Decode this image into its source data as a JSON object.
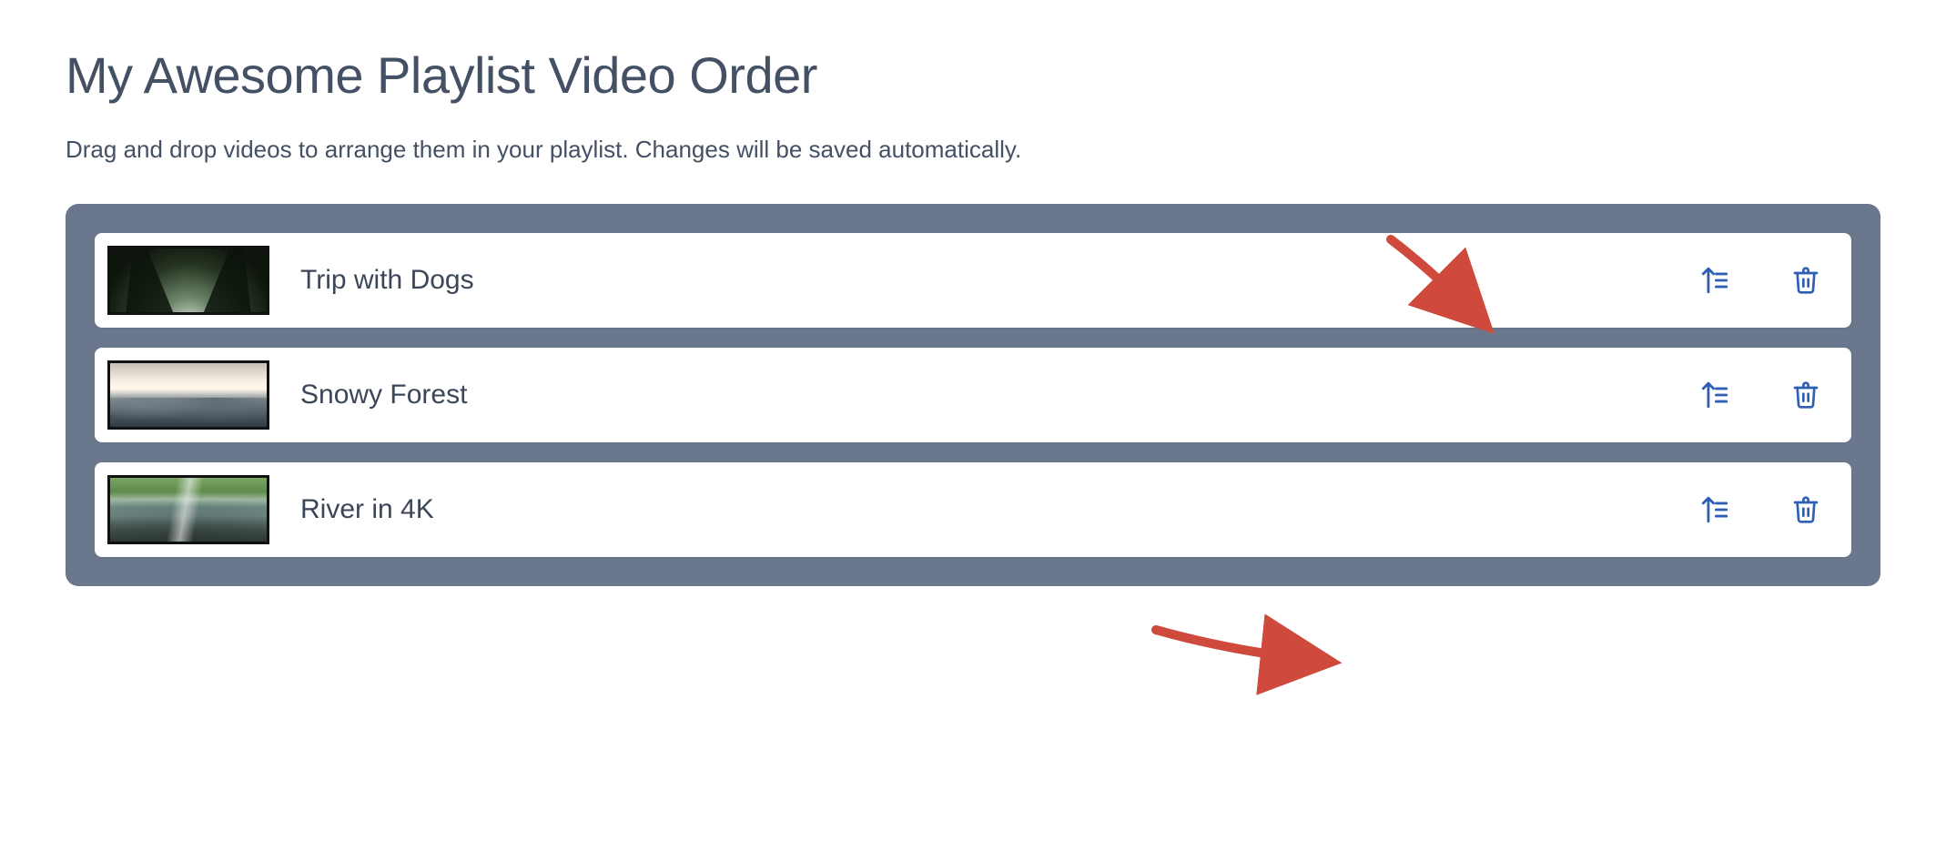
{
  "header": {
    "title": "My Awesome Playlist Video Order",
    "subtitle": "Drag and drop videos to arrange them in your playlist. Changes will be saved automatically."
  },
  "playlist": {
    "items": [
      {
        "title": "Trip with Dogs",
        "thumb_class": "forest-trees"
      },
      {
        "title": "Snowy Forest",
        "thumb_class": "snowy-sunrise"
      },
      {
        "title": "River in 4K",
        "thumb_class": "river"
      }
    ]
  },
  "icons": {
    "move_to_top": "move-to-top-icon",
    "delete": "trash-icon"
  },
  "colors": {
    "panel_bg": "#6b778d",
    "text": "#445064",
    "icon_accent": "#2f5fb3",
    "annotation_arrow": "#cf4a3d"
  }
}
